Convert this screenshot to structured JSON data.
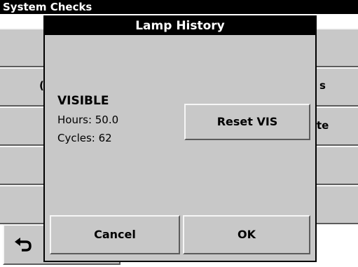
{
  "screen": {
    "title": "System Checks",
    "row_fragments": [
      "(",
      "s",
      "te"
    ]
  },
  "dialog": {
    "title": "Lamp History",
    "lamp_name": "VISIBLE",
    "hours_label": "Hours: 50.0",
    "cycles_label": "Cycles: 62",
    "reset_label": "Reset VIS",
    "cancel_label": "Cancel",
    "ok_label": "OK"
  },
  "icons": {
    "back": "back-arrow-icon"
  },
  "colors": {
    "panel": "#c8c8c8",
    "header": "#000000",
    "highlight": "#f6f6f6",
    "shadow": "#5c5c5c"
  }
}
